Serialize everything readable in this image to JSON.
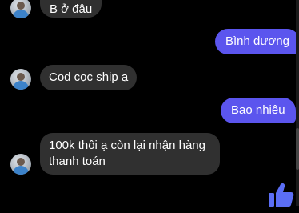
{
  "messages": [
    {
      "direction": "incoming",
      "text": "B ở đâu"
    },
    {
      "direction": "outgoing",
      "text": "Bình dương"
    },
    {
      "direction": "incoming",
      "text": "Cod cọc ship ạ"
    },
    {
      "direction": "outgoing",
      "text": "Bao nhiêu"
    },
    {
      "direction": "incoming",
      "text_line1": "100k thôi ạ còn lại nhận hàng",
      "text_line2": "thanh toán"
    }
  ],
  "colors": {
    "background": "#000000",
    "incoming_bubble": "#303030",
    "outgoing_bubble": "#5b55ee",
    "like_icon": "#5b6ef5"
  },
  "icons": {
    "like": "thumbs-up-icon",
    "avatar": "contact-avatar"
  }
}
